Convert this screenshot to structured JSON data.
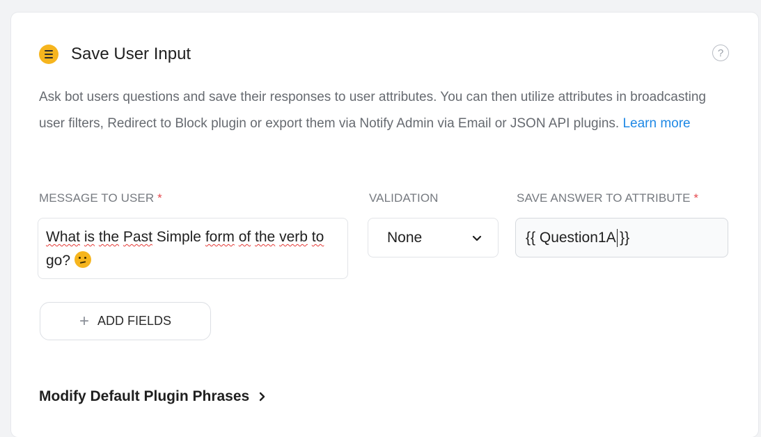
{
  "plugin": {
    "title": "Save User Input",
    "icon": "menu-lines-icon",
    "accent_color": "#f6b51e",
    "help_icon_glyph": "?"
  },
  "description": {
    "text": "Ask bot users questions and save their responses to user attributes. You can then utilize attributes in broadcasting user filters, Redirect to Block plugin or export them via Notify Admin via Email or JSON API plugins.",
    "link_label": "Learn more",
    "link_color": "#1e88e5"
  },
  "fields": {
    "message": {
      "label": "MESSAGE TO USER",
      "required_mark": "*",
      "value_words": [
        "What",
        "is",
        "the",
        "Past",
        "Simple",
        "form",
        "of",
        "the",
        "verb",
        "to",
        "go?"
      ]
    },
    "validation": {
      "label": "VALIDATION",
      "selected": "None"
    },
    "attribute": {
      "label": "SAVE ANSWER TO ATTRIBUTE",
      "required_mark": "*",
      "value_before_cursor": "{{ Question1A",
      "value_after_cursor": "}}"
    }
  },
  "add_fields": {
    "plus_glyph": "+",
    "label": "ADD FIELDS"
  },
  "modify_phrases": {
    "label": "Modify Default Plugin Phrases"
  }
}
